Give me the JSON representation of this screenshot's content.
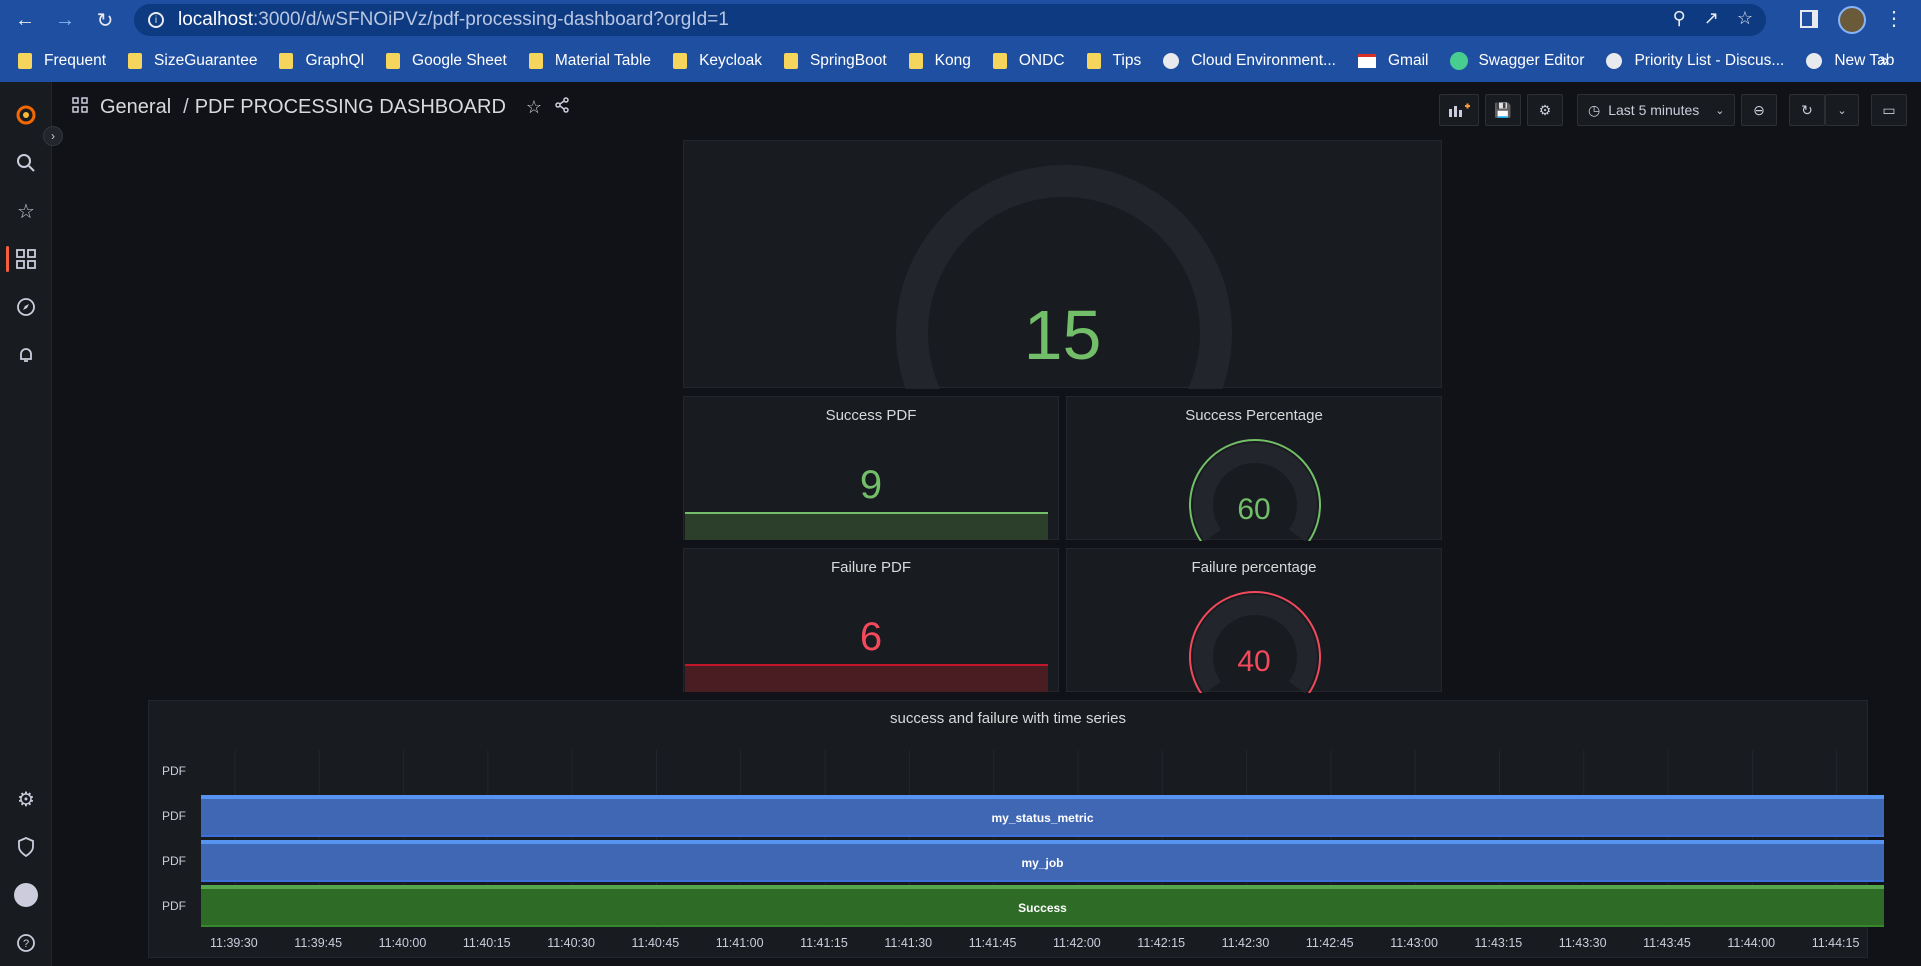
{
  "browser": {
    "url_host": "localhost",
    "url_path": ":3000/d/wSFNOiPVz/pdf-processing-dashboard?orgId=1",
    "bookmarks": [
      {
        "label": "Frequent",
        "icon": "folder-icon"
      },
      {
        "label": "SizeGuarantee",
        "icon": "folder-icon"
      },
      {
        "label": "GraphQl",
        "icon": "folder-icon"
      },
      {
        "label": "Google Sheet",
        "icon": "folder-icon"
      },
      {
        "label": "Material Table",
        "icon": "folder-icon"
      },
      {
        "label": "Keycloak",
        "icon": "folder-icon"
      },
      {
        "label": "SpringBoot",
        "icon": "folder-icon"
      },
      {
        "label": "Kong",
        "icon": "folder-icon"
      },
      {
        "label": "ONDC",
        "icon": "folder-icon"
      },
      {
        "label": "Tips",
        "icon": "folder-icon"
      },
      {
        "label": "Cloud Environment...",
        "icon": "globe-icon"
      },
      {
        "label": "Gmail",
        "icon": "gmail-icon"
      },
      {
        "label": "Swagger Editor",
        "icon": "swagger-icon"
      },
      {
        "label": "Priority List - Discus...",
        "icon": "globe-icon"
      },
      {
        "label": "New Tab",
        "icon": "globe-icon"
      }
    ],
    "more_bookmarks": "»"
  },
  "header": {
    "folder": "General",
    "separator": "/",
    "title": "PDF PROCESSING DASHBOARD",
    "time_range": "Last 5 minutes"
  },
  "panels": {
    "total": {
      "value": "15",
      "level_fraction": 0.15,
      "color": "#73bf69"
    },
    "success_pdf": {
      "title": "Success PDF",
      "value": "9",
      "color": "#73bf69"
    },
    "success_percentage": {
      "title": "Success Percentage",
      "value": "60",
      "level_fraction": 0.6,
      "color": "#73bf69"
    },
    "failure_pdf": {
      "title": "Failure PDF",
      "value": "6",
      "color": "#f2495c"
    },
    "failure_percentage": {
      "title": "Failure percentage",
      "value": "40",
      "level_fraction": 0.4,
      "color": "#f2495c"
    }
  },
  "timeseries": {
    "title": "success and failure with time series",
    "row_labels": [
      "PDF",
      "PDF",
      "PDF",
      "PDF"
    ],
    "bars": [
      {
        "label": "my_status_metric",
        "color": "#3d71d9"
      },
      {
        "label": "my_job",
        "color": "#3d71d9"
      },
      {
        "label": "Success",
        "color": "#37872d"
      }
    ],
    "ticks": [
      "11:39:30",
      "11:39:45",
      "11:40:00",
      "11:40:15",
      "11:40:30",
      "11:40:45",
      "11:41:00",
      "11:41:15",
      "11:41:30",
      "11:41:45",
      "11:42:00",
      "11:42:15",
      "11:42:30",
      "11:42:45",
      "11:43:00",
      "11:43:15",
      "11:43:30",
      "11:43:45",
      "11:44:00",
      "11:44:15"
    ]
  }
}
